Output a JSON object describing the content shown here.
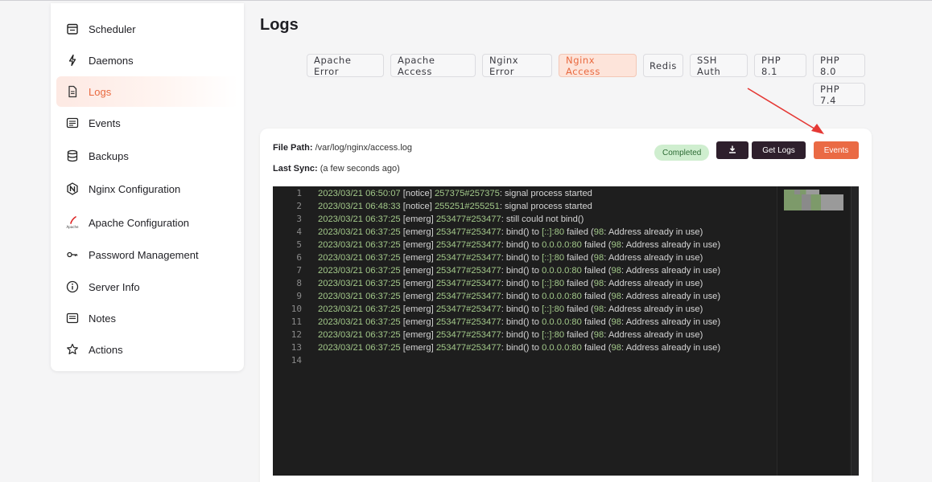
{
  "sidebar": {
    "items": [
      {
        "label": "Scheduler",
        "icon": "calendar-icon",
        "active": false
      },
      {
        "label": "Daemons",
        "icon": "bolt-icon",
        "active": false
      },
      {
        "label": "Logs",
        "icon": "file-text-icon",
        "active": true
      },
      {
        "label": "Events",
        "icon": "list-icon",
        "active": false
      },
      {
        "label": "Backups",
        "icon": "database-icon",
        "active": false
      },
      {
        "label": "Nginx Configuration",
        "icon": "nginx-icon",
        "active": false
      },
      {
        "label": "Apache Configuration",
        "icon": "apache-feather-icon",
        "active": false
      },
      {
        "label": "Password Management",
        "icon": "key-icon",
        "active": false
      },
      {
        "label": "Server Info",
        "icon": "info-icon",
        "active": false
      },
      {
        "label": "Notes",
        "icon": "notes-icon",
        "active": false
      },
      {
        "label": "Actions",
        "icon": "star-icon",
        "active": false
      }
    ],
    "apache_icon_text": "Apache"
  },
  "page": {
    "title": "Logs"
  },
  "tabs": [
    {
      "label": "Apache Error",
      "active": false
    },
    {
      "label": "Apache Access",
      "active": false
    },
    {
      "label": "Nginx Error",
      "active": false
    },
    {
      "label": "Nginx Access",
      "active": true
    },
    {
      "label": "Redis",
      "active": false
    },
    {
      "label": "SSH Auth",
      "active": false
    },
    {
      "label": "PHP 8.1",
      "active": false
    },
    {
      "label": "PHP 8.0",
      "active": false
    },
    {
      "label": "PHP 7.4",
      "active": false
    }
  ],
  "log": {
    "file_path_label": "File Path:",
    "file_path": "/var/log/nginx/access.log",
    "last_sync_label": "Last Sync:",
    "last_sync": "(a few seconds ago)",
    "status": "Completed",
    "get_logs_label": "Get Logs",
    "events_label": "Events"
  },
  "editor": {
    "lines": [
      {
        "n": "1",
        "ts": "2023/03/21 06:50:07",
        "rest": " [notice] ",
        "pid": "257375#257375",
        "msg": ": signal process started"
      },
      {
        "n": "2",
        "ts": "2023/03/21 06:48:33",
        "rest": " [notice] ",
        "pid": "255251#255251",
        "msg": ": signal process started"
      },
      {
        "n": "3",
        "ts": "2023/03/21 06:37:25",
        "rest": " [emerg] ",
        "pid": "253477#253477",
        "msg": ": still could not bind()"
      },
      {
        "n": "4",
        "ts": "2023/03/21 06:37:25",
        "rest": " [emerg] ",
        "pid": "253477#253477",
        "msg": ": bind() to [::]:80 failed (98: Address already in use)"
      },
      {
        "n": "5",
        "ts": "2023/03/21 06:37:25",
        "rest": " [emerg] ",
        "pid": "253477#253477",
        "msg": ": bind() to 0.0.0.0:80 failed (98: Address already in use)"
      },
      {
        "n": "6",
        "ts": "2023/03/21 06:37:25",
        "rest": " [emerg] ",
        "pid": "253477#253477",
        "msg": ": bind() to [::]:80 failed (98: Address already in use)"
      },
      {
        "n": "7",
        "ts": "2023/03/21 06:37:25",
        "rest": " [emerg] ",
        "pid": "253477#253477",
        "msg": ": bind() to 0.0.0.0:80 failed (98: Address already in use)"
      },
      {
        "n": "8",
        "ts": "2023/03/21 06:37:25",
        "rest": " [emerg] ",
        "pid": "253477#253477",
        "msg": ": bind() to [::]:80 failed (98: Address already in use)"
      },
      {
        "n": "9",
        "ts": "2023/03/21 06:37:25",
        "rest": " [emerg] ",
        "pid": "253477#253477",
        "msg": ": bind() to 0.0.0.0:80 failed (98: Address already in use)"
      },
      {
        "n": "10",
        "ts": "2023/03/21 06:37:25",
        "rest": " [emerg] ",
        "pid": "253477#253477",
        "msg": ": bind() to [::]:80 failed (98: Address already in use)"
      },
      {
        "n": "11",
        "ts": "2023/03/21 06:37:25",
        "rest": " [emerg] ",
        "pid": "253477#253477",
        "msg": ": bind() to 0.0.0.0:80 failed (98: Address already in use)"
      },
      {
        "n": "12",
        "ts": "2023/03/21 06:37:25",
        "rest": " [emerg] ",
        "pid": "253477#253477",
        "msg": ": bind() to [::]:80 failed (98: Address already in use)"
      },
      {
        "n": "13",
        "ts": "2023/03/21 06:37:25",
        "rest": " [emerg] ",
        "pid": "253477#253477",
        "msg": ": bind() to 0.0.0.0:80 failed (98: Address already in use)"
      },
      {
        "n": "14",
        "ts": "",
        "rest": "",
        "pid": "",
        "msg": ""
      }
    ]
  },
  "colors": {
    "accent": "#e9693f",
    "dark_button": "#2e1f2c",
    "events_button": "#ea6a44",
    "editor_bg": "#1e1e1e",
    "editor_green": "#a3c98a",
    "badge_bg": "#cfeecf",
    "annotation_arrow": "#e53935"
  }
}
